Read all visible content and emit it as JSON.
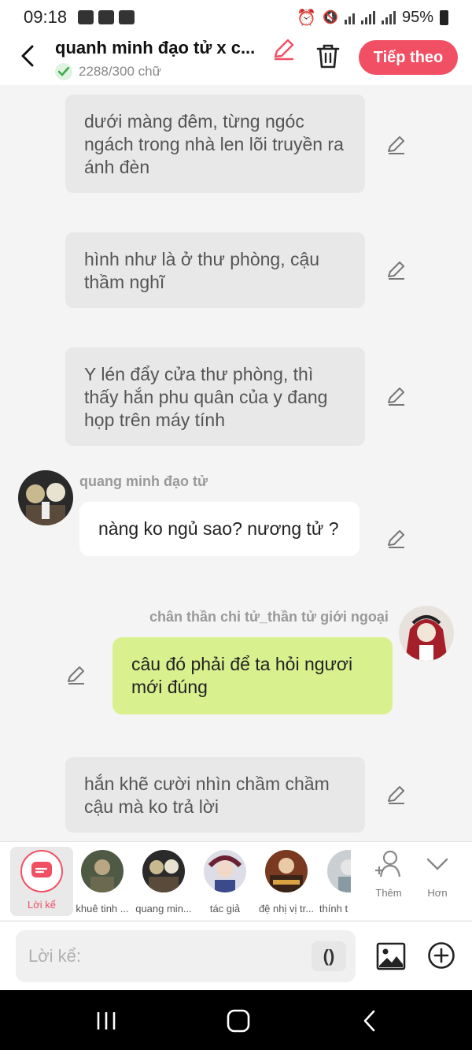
{
  "status_bar": {
    "time": "09:18",
    "battery": "95%"
  },
  "header": {
    "title": "quanh minh đạo tử x c...",
    "word_count": "2288/300 chữ",
    "next_label": "Tiếp theo"
  },
  "messages": {
    "narr1": "dưới màng đêm, từng ngóc ngách trong nhà len lõi truyền ra ánh đèn",
    "narr2": "hình như là ở thư phòng, cậu thầm nghĩ",
    "narr3": "Y lén đẩy cửa thư phòng, thì thấy hắn phu quân của y đang họp trên máy tính",
    "msg1_name": "quang minh đạo tử",
    "msg1_text": "nàng ko ngủ sao? nương tử ?",
    "msg2_name": "chân thần chi tử_thần tử giới ngoại",
    "msg2_text": "câu đó phải để ta hỏi ngươi mới đúng",
    "narr4": "hắn khẽ cười nhìn chầm chầm cậu mà ko trả lời"
  },
  "characters": [
    {
      "label": "Lời kể"
    },
    {
      "label": "khuê tinh ..."
    },
    {
      "label": "quang min..."
    },
    {
      "label": "tác giả"
    },
    {
      "label": "đệ nhị vị tr..."
    },
    {
      "label": "thính t"
    }
  ],
  "controls": {
    "add_label": "Thêm",
    "more_label": "Hơn"
  },
  "input": {
    "placeholder": "Lời kể:",
    "paren": "()"
  },
  "colors": {
    "accent": "#f14f64",
    "own_bubble": "#d8f08e",
    "narration_bg": "#e8e8e8"
  }
}
